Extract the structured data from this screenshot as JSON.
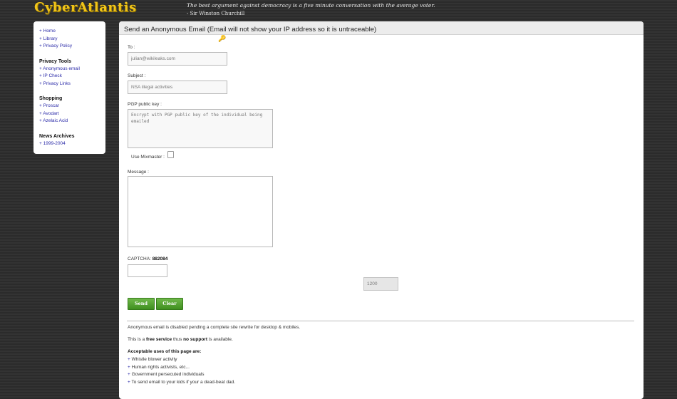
{
  "site": {
    "logo": "CyberAtlantis"
  },
  "quote": {
    "text": "The best argument against democracy is a five minute conversation with the average voter.",
    "author": "- Sir Winston Churchill"
  },
  "sidebar": {
    "links": [
      "Home",
      "Library",
      "Privacy Policy"
    ],
    "sections": [
      {
        "heading": "Privacy Tools",
        "links": [
          "Anonymous email",
          "IP Check",
          "Privacy Links"
        ]
      },
      {
        "heading": "Shopping",
        "links": [
          "Proscar",
          "Avodart",
          "Azelaic Acid"
        ]
      },
      {
        "heading": "News Archives",
        "links": [
          "1999-2004"
        ]
      }
    ]
  },
  "form": {
    "header": "Send an Anonymous Email (Email will not show your IP address so it is untraceable)",
    "to_label": "To :",
    "to_value": "julian@wikileaks.com",
    "subject_label": "Subject :",
    "subject_value": "NSA illegal activities",
    "pgp_label": "PGP public key :",
    "pgp_placeholder": "Encrypt with PGP public key of the individual being emailed",
    "mixmaster_label": "Use Mixmaster :",
    "message_label": "Message :",
    "captcha_label": "CAPTCHA:",
    "captcha_code": "882084",
    "captcha_value": "",
    "char_count": "1200",
    "send_label": "Send",
    "clear_label": "Clear"
  },
  "notes": {
    "disabled": "Anonymous email is disabled pending a complete site rewrite for desktop & mobiles.",
    "service_prefix": "This is a ",
    "service_bold1": "free service",
    "service_mid": " thus ",
    "service_bold2": "no support",
    "service_suffix": " is available.",
    "uses_title": "Acceptable uses of this page are:",
    "uses": [
      "Whistle blower activity",
      "Human rights activists, etc...",
      "Government persecuted individuals",
      "To send email to your kids if your a dead-beat dad."
    ]
  },
  "colors": {
    "logo": "#f0c419",
    "link": "#2a2aa8",
    "button": "#4a9a2a",
    "background": "#2e2e2e"
  }
}
